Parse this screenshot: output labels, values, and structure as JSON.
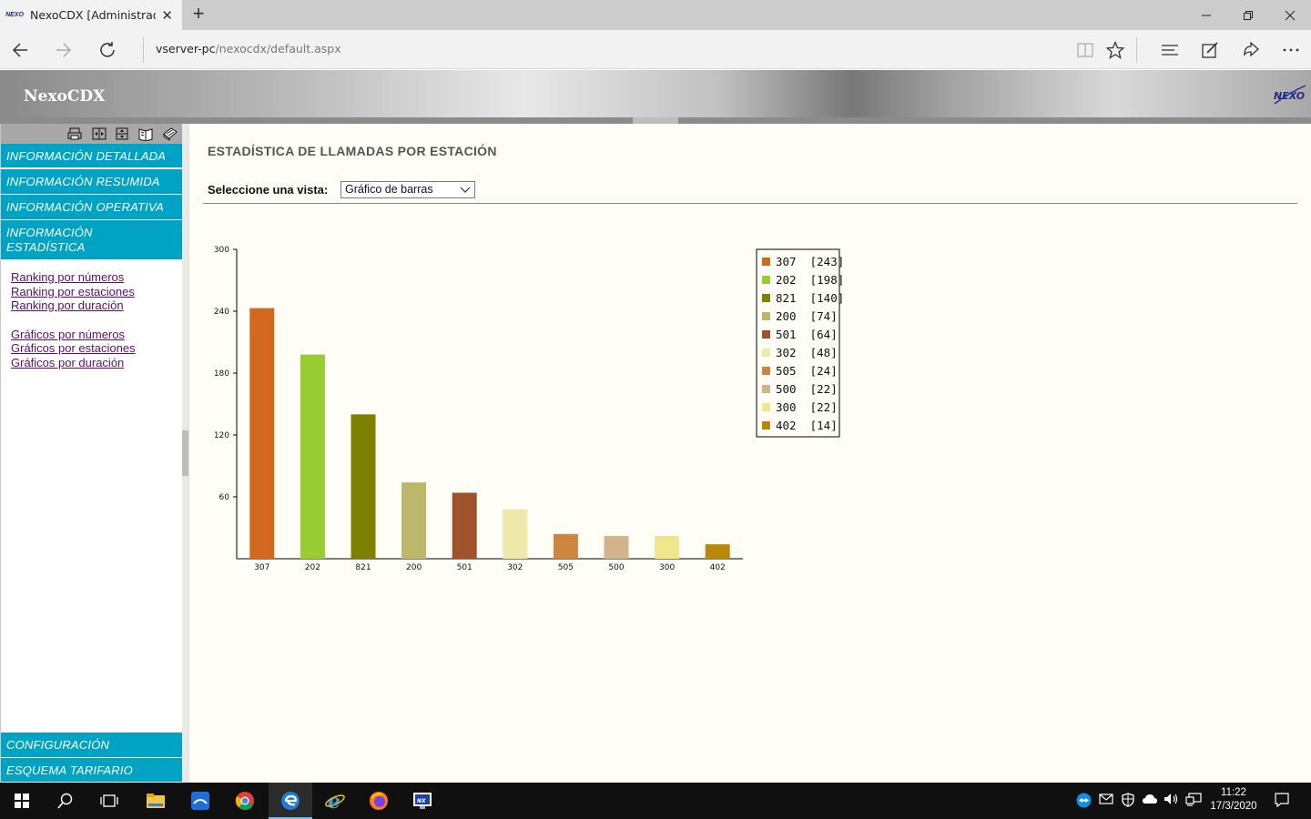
{
  "browser": {
    "tab_title": "NexoCDX [Administrado",
    "favicon_text": "NEXO",
    "url_host": "vserver-pc",
    "url_path": "/nexocdx/default.aspx"
  },
  "app": {
    "title": "NexoCDX",
    "logo_text": "NEXO"
  },
  "sidebar": {
    "menu": [
      {
        "label": "INFORMACIÓN DETALLADA"
      },
      {
        "label": "INFORMACIÓN RESUMIDA"
      },
      {
        "label": "INFORMACIÓN OPERATIVA"
      },
      {
        "label": "INFORMACIÓN ESTADÍSTICA"
      }
    ],
    "links": [
      "Ranking por números",
      "Ranking por estaciones",
      "Ranking por duración",
      "Gráficos por números",
      "Gráficos por estaciones",
      "Gráficos por duración"
    ],
    "bottom_menu": [
      {
        "label": "CONFIGURACIÓN"
      },
      {
        "label": "ESQUEMA TARIFARIO"
      }
    ]
  },
  "content": {
    "title": "ESTADÍSTICA DE LLAMADAS POR ESTACIÓN",
    "view_label": "Seleccione una vista:",
    "view_selected": "Gráfico de barras"
  },
  "chart_data": {
    "type": "bar",
    "title": "",
    "xlabel": "",
    "ylabel": "",
    "categories": [
      "307",
      "202",
      "821",
      "200",
      "501",
      "302",
      "505",
      "500",
      "300",
      "402"
    ],
    "values": [
      243,
      198,
      140,
      74,
      64,
      48,
      24,
      22,
      22,
      14
    ],
    "colors": [
      "#d2691e",
      "#9acd32",
      "#808000",
      "#bdb76b",
      "#a0522d",
      "#eee8aa",
      "#cd853f",
      "#d2b48c",
      "#f0e68c",
      "#b8860b"
    ],
    "ylim": [
      0,
      300
    ],
    "yticks": [
      60,
      120,
      180,
      240,
      300
    ],
    "legend": [
      "307  [243]",
      "202  [198]",
      "821  [140]",
      "200  [74]",
      "501  [64]",
      "302  [48]",
      "505  [24]",
      "500  [22]",
      "300  [22]",
      "402  [14]"
    ],
    "legend_position": "right",
    "grid": false
  },
  "taskbar": {
    "time": "11:22",
    "date": "17/3/2020"
  }
}
